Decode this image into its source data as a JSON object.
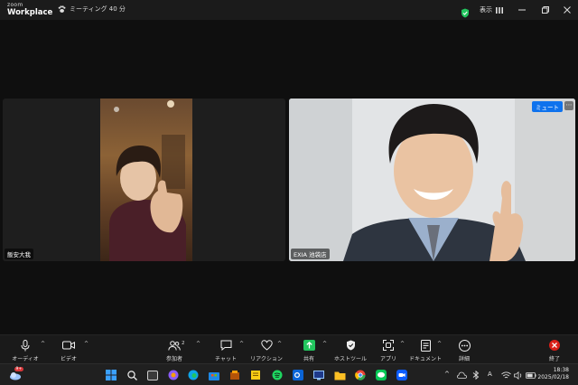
{
  "app": {
    "brand_small": "zoom",
    "brand": "Workplace"
  },
  "meeting": {
    "title": "ミーティング 40 分"
  },
  "titlebar": {
    "view_label": "表示"
  },
  "participants": [
    {
      "name": "飯安大我"
    },
    {
      "name": "EXIA 池袋店",
      "tag": "ミュート"
    }
  ],
  "toolbar": {
    "audio": "オーディオ",
    "video": "ビデオ",
    "participants": "参加者",
    "participants_count": "2",
    "chat": "チャット",
    "reactions": "リアクション",
    "share": "共有",
    "host_tools": "ホストツール",
    "apps": "アプリ",
    "docs": "ドキュメント",
    "more": "詳細",
    "end": "終了"
  },
  "taskbar": {
    "time": "18:38",
    "date": "2025/02/18",
    "ime": "A",
    "notif_count": "9+"
  },
  "colors": {
    "accent": "#0e72ed",
    "end_red": "#d91e18",
    "share_green": "#22c55e"
  }
}
